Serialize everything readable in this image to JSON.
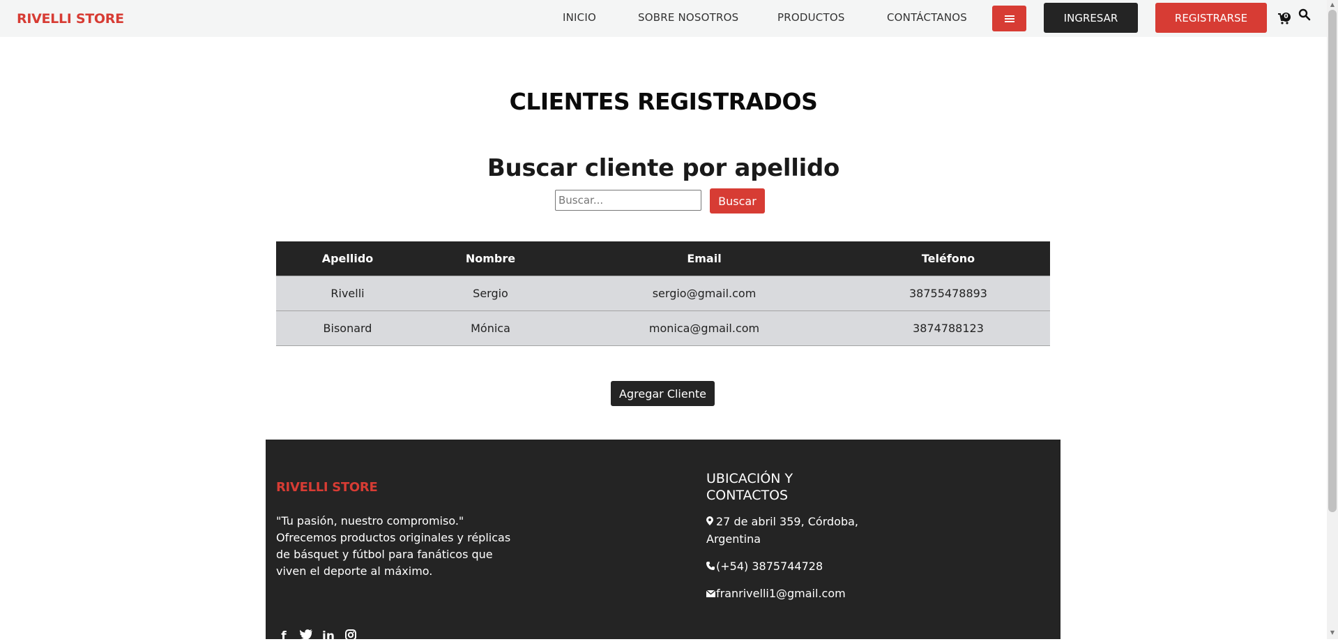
{
  "nav": {
    "brand": "RIVELLI STORE",
    "links": [
      "INICIO",
      "SOBRE NOSOTROS",
      "PRODUCTOS",
      "CONTÁCTANOS"
    ],
    "menu_icon": "bars-icon",
    "login_label": "INGRESAR",
    "register_label": "REGISTRARSE",
    "cart_icon": "cart-icon",
    "cart_count": "0",
    "search_icon": "search-icon"
  },
  "main": {
    "title": "CLIENTES REGISTRADOS",
    "search_heading": "Buscar cliente por apellido",
    "search_placeholder": "Buscar...",
    "search_value": "",
    "search_button": "Buscar",
    "add_button": "Agregar Cliente"
  },
  "table": {
    "headers": [
      "Apellido",
      "Nombre",
      "Email",
      "Teléfono"
    ],
    "rows": [
      [
        "Rivelli",
        "Sergio",
        "sergio@gmail.com",
        "38755478893"
      ],
      [
        "Bisonard",
        "Mónica",
        "monica@gmail.com",
        "3874788123"
      ]
    ]
  },
  "footer": {
    "brand": "RIVELLI STORE",
    "description": "\"Tu pasión, nuestro compromiso.\" Ofrecemos productos originales y réplicas de básquet y fútbol para fanáticos que viven el deporte al máximo.",
    "contact_heading": "UBICACIÓN Y CONTACTOS",
    "address": "27 de abril 359, Córdoba, Argentina",
    "phone": "(+54) 3875744728",
    "email": "franrivelli1@gmail.com",
    "social_icons": [
      "facebook-icon",
      "twitter-icon",
      "linkedin-icon",
      "instagram-icon"
    ]
  },
  "colors": {
    "accent": "#d73c34",
    "dark": "#242424",
    "nav_bg": "#f4f5f5",
    "row_bg": "#d9dadd"
  }
}
